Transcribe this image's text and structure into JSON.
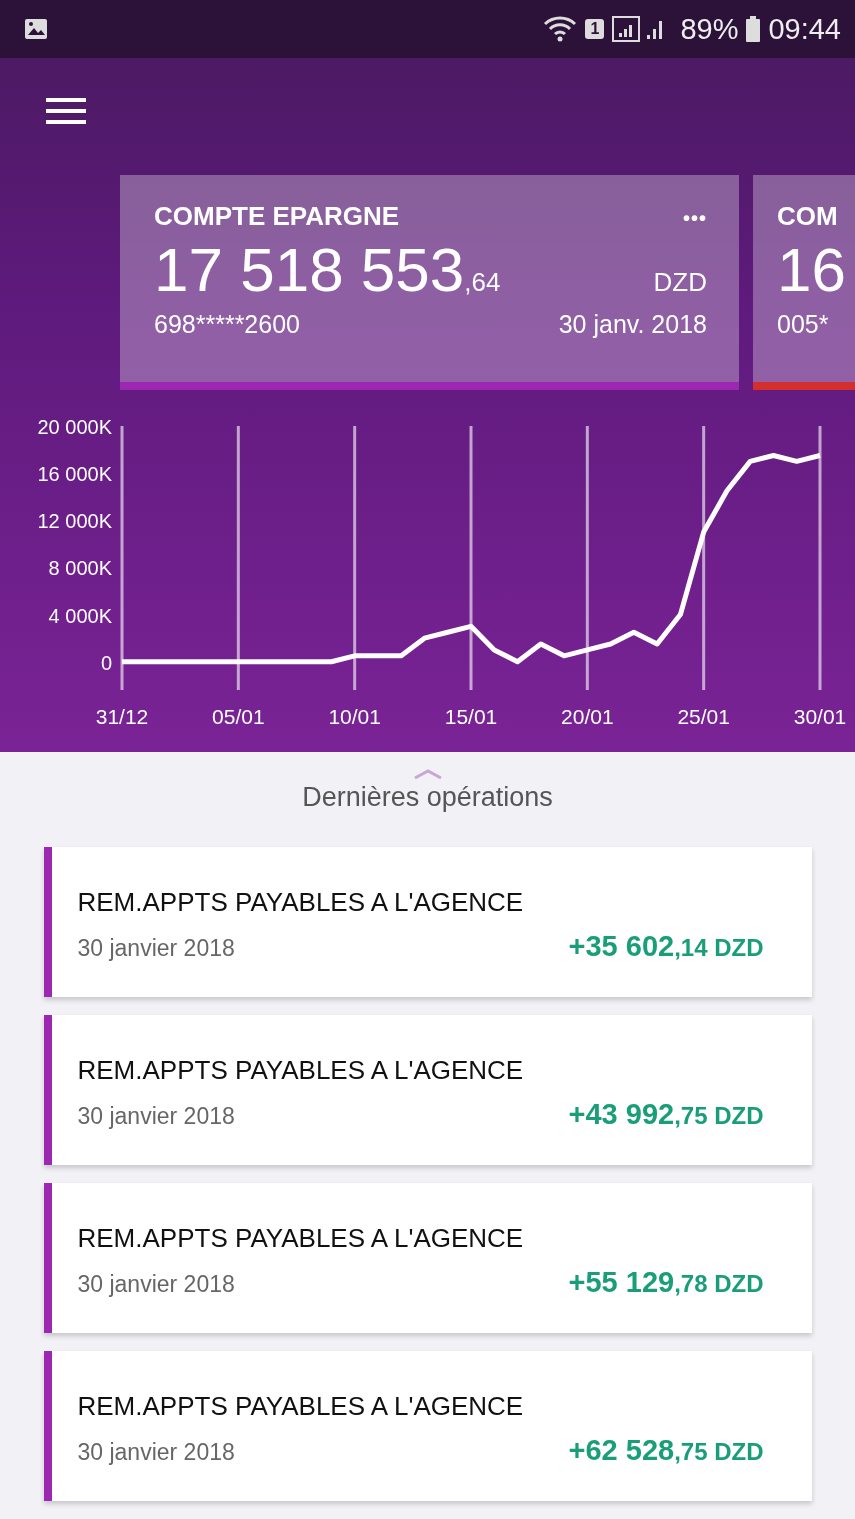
{
  "status_bar": {
    "battery": "89%",
    "time": "09:44",
    "sim": "1"
  },
  "accounts": [
    {
      "title": "COMPTE EPARGNE",
      "balance": "17 518 553",
      "cents": ",64",
      "currency": "DZD",
      "number": "698*****2600",
      "date": "30 janv. 2018",
      "color": "#9c27b0",
      "menu": "•••"
    },
    {
      "title": "COM",
      "balance": "16",
      "number": "005*",
      "color": "#d32f2f"
    }
  ],
  "chart_data": {
    "type": "line",
    "categories": [
      "31/12",
      null,
      null,
      null,
      null,
      "05/01",
      null,
      null,
      null,
      null,
      "10/01",
      null,
      null,
      null,
      null,
      "15/01",
      null,
      null,
      null,
      null,
      "20/01",
      null,
      null,
      null,
      null,
      "25/01",
      null,
      null,
      null,
      null,
      "30/01"
    ],
    "series": [
      {
        "color": "#ffffff",
        "values": [
          0,
          0,
          0,
          0,
          0,
          0,
          0,
          0,
          0,
          0,
          500,
          500,
          500,
          2000,
          2500,
          3000,
          1000,
          0,
          1500,
          500,
          1000,
          1500,
          2500,
          1500,
          4000,
          11000,
          14500,
          17000,
          17500,
          17000,
          17500
        ]
      }
    ],
    "yticks": [
      {
        "value": 0,
        "label": "0"
      },
      {
        "value": 4000,
        "label": "4 000K"
      },
      {
        "value": 8000,
        "label": "8 000K"
      },
      {
        "value": 12000,
        "label": "12 000K"
      },
      {
        "value": 16000,
        "label": "16 000K"
      },
      {
        "value": 20000,
        "label": "20 000K"
      }
    ],
    "ylim": [
      -2400,
      20000
    ],
    "grid": true
  },
  "operations_title": "Dernières opérations",
  "operations": [
    {
      "label": "REM.APPTS PAYABLES A L'AGENCE",
      "date": "30 janvier 2018",
      "amount": "+35 602",
      "cents": ",14 DZD"
    },
    {
      "label": "REM.APPTS PAYABLES A L'AGENCE",
      "date": "30 janvier 2018",
      "amount": "+43 992",
      "cents": ",75 DZD"
    },
    {
      "label": "REM.APPTS PAYABLES A L'AGENCE",
      "date": "30 janvier 2018",
      "amount": "+55 129",
      "cents": ",78 DZD"
    },
    {
      "label": "REM.APPTS PAYABLES A L'AGENCE",
      "date": "30 janvier 2018",
      "amount": "+62 528",
      "cents": ",75 DZD"
    }
  ]
}
